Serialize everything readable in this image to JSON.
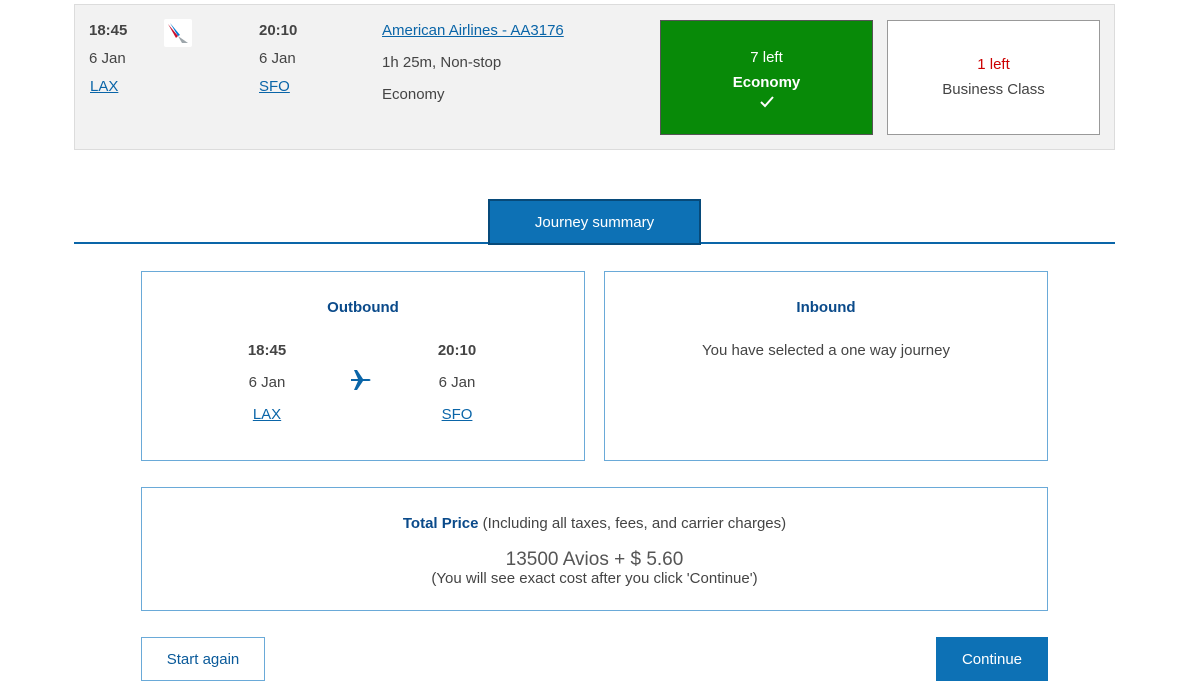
{
  "flight": {
    "depart_time": "18:45",
    "depart_date": "6 Jan",
    "depart_airport": "LAX",
    "arrive_time": "20:10",
    "arrive_date": "6 Jan",
    "arrive_airport": "SFO",
    "airline_link": "American Airlines - AA3176",
    "duration": "1h 25m, Non-stop",
    "cabin": "Economy",
    "airline_logo_icon": "american-airlines-logo"
  },
  "cabins": [
    {
      "seats": "7 left",
      "name": "Economy",
      "selected": true,
      "color": "#088a08",
      "check_icon": "checkmark-icon"
    },
    {
      "seats": "1 left",
      "name": "Business Class",
      "selected": false,
      "seats_color": "#cc0000"
    }
  ],
  "tab": {
    "label": "Journey summary"
  },
  "outbound": {
    "title": "Outbound",
    "depart_time": "18:45",
    "depart_date": "6 Jan",
    "depart_airport": "LAX",
    "arrive_time": "20:10",
    "arrive_date": "6 Jan",
    "arrive_airport": "SFO",
    "icon": "plane-icon"
  },
  "inbound": {
    "title": "Inbound",
    "message": "You have selected a one way journey"
  },
  "price": {
    "label": "Total Price",
    "label_suffix": "(Including all taxes, fees, and carrier charges)",
    "amount": "13500 Avios + $ 5.60",
    "note": "(You will see exact cost after you click 'Continue')"
  },
  "buttons": {
    "start_again": "Start again",
    "continue": "Continue"
  },
  "colors": {
    "brand_blue": "#0d71b5",
    "economy_green": "#088a08",
    "seats_red": "#cc0000"
  }
}
